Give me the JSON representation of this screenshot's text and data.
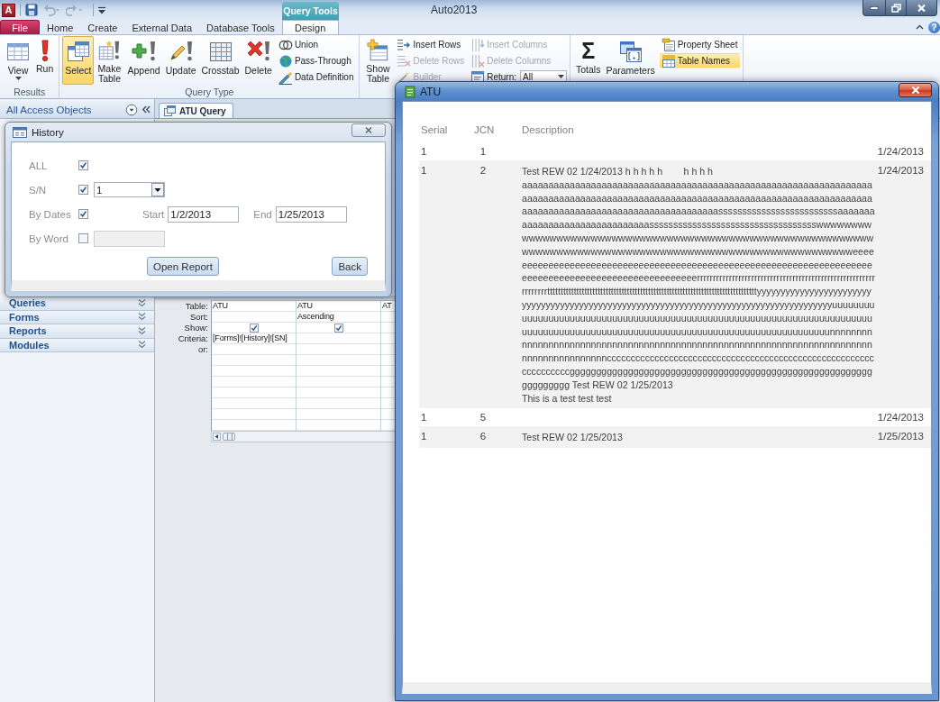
{
  "window": {
    "app_logo": "A",
    "title": "Auto2013",
    "contextual_group": "Query Tools",
    "help_symbol": "?"
  },
  "quick_access": [
    {
      "disabled": false
    },
    {
      "disabled": true
    },
    {
      "disabled": true
    }
  ],
  "ribbon": {
    "tabs": [
      {
        "label": "File",
        "kind": "backstage",
        "selected": false
      },
      {
        "label": "Home",
        "kind": "standard",
        "selected": false
      },
      {
        "label": "Create",
        "kind": "standard",
        "selected": false
      },
      {
        "label": "External Data",
        "kind": "standard",
        "selected": false
      },
      {
        "label": "Database Tools",
        "kind": "standard",
        "selected": false
      },
      {
        "label": "Design",
        "kind": "contextual",
        "selected": true
      }
    ],
    "groups": [
      {
        "label": "Results",
        "items": [
          {
            "kind": "large",
            "label": "View",
            "dropdown": true,
            "selected": false,
            "disabled": false
          },
          {
            "kind": "large",
            "label": "Run",
            "selected": false,
            "disabled": false
          }
        ]
      },
      {
        "label": "Query Type",
        "items": [
          {
            "kind": "large",
            "label": "Select",
            "selected": true,
            "disabled": false
          },
          {
            "kind": "large",
            "label": "Make Table",
            "selected": false,
            "disabled": false
          },
          {
            "kind": "large",
            "label": "Append",
            "selected": false,
            "disabled": false
          },
          {
            "kind": "large",
            "label": "Update",
            "selected": false,
            "disabled": false
          },
          {
            "kind": "large",
            "label": "Crosstab",
            "selected": false,
            "disabled": false
          },
          {
            "kind": "large",
            "label": "Delete",
            "selected": false,
            "disabled": false
          },
          {
            "kind": "stack",
            "items": [
              {
                "kind": "small",
                "label": "Union",
                "selected": false,
                "disabled": false
              },
              {
                "kind": "small",
                "label": "Pass-Through",
                "selected": false,
                "disabled": false
              },
              {
                "kind": "small",
                "label": "Data Definition",
                "selected": false,
                "disabled": false
              }
            ]
          }
        ]
      },
      {
        "items": [
          {
            "kind": "large",
            "label": "Show Table",
            "selected": false,
            "disabled": false
          },
          {
            "kind": "stack",
            "items": [
              {
                "kind": "small",
                "label": "Insert Rows",
                "selected": false,
                "disabled": false
              },
              {
                "kind": "small",
                "label": "Delete Rows",
                "selected": false,
                "disabled": true
              },
              {
                "kind": "small",
                "label": "Builder",
                "selected": false,
                "disabled": true
              }
            ]
          },
          {
            "kind": "stack",
            "items": [
              {
                "kind": "small",
                "label": "Insert Columns",
                "selected": false,
                "disabled": true
              },
              {
                "kind": "small",
                "label": "Delete Columns",
                "selected": false,
                "disabled": true
              },
              {
                "kind": "combo",
                "label": "Return:",
                "value": "All",
                "disabled": false
              }
            ]
          }
        ]
      },
      {
        "items": [
          {
            "kind": "large",
            "label": "Totals",
            "symbol": "Σ",
            "selected": false,
            "disabled": false
          },
          {
            "kind": "large",
            "label": "Parameters",
            "selected": false,
            "disabled": false
          },
          {
            "kind": "stack",
            "items": [
              {
                "kind": "small",
                "label": "Property Sheet",
                "selected": false,
                "disabled": false
              },
              {
                "kind": "small",
                "label": "Table Names",
                "selected": true,
                "disabled": false
              }
            ]
          }
        ]
      }
    ]
  },
  "nav_pane": {
    "title": "All Access Objects",
    "groups": [
      {
        "label": "Queries",
        "expanded": false
      },
      {
        "label": "Forms",
        "expanded": false
      },
      {
        "label": "Reports",
        "expanded": false
      },
      {
        "label": "Modules",
        "expanded": false
      }
    ]
  },
  "document_tabs": [
    {
      "label": "ATU Query",
      "selected": true
    }
  ],
  "query_grid": {
    "row_labels": [
      "Table:",
      "Sort:",
      "Show:",
      "Criteria:",
      "or:"
    ],
    "columns": [
      {
        "table": "ATU",
        "show": true,
        "criteria": "[Forms]![History]![SN]"
      },
      {
        "table": "ATU",
        "sort": "Ascending",
        "show": true
      },
      {
        "table": "AT"
      }
    ]
  },
  "history_dialog": {
    "title": "History",
    "rows": [
      {
        "kind": "check",
        "label": "ALL",
        "checked": true
      },
      {
        "kind": "combo",
        "label": "S/N",
        "checked": true,
        "value": "1"
      },
      {
        "kind": "date_range",
        "label": "By Dates",
        "checked": true,
        "start_label": "Start",
        "start": "1/2/2013",
        "end_label": "End",
        "end": "1/25/2013"
      },
      {
        "kind": "text",
        "label": "By Word",
        "checked": false,
        "disabled": true
      }
    ],
    "buttons": [
      "Open Report",
      "Back"
    ]
  },
  "report_window": {
    "title": "ATU",
    "columns": [
      "Serial",
      "JCN",
      "Description"
    ],
    "rows": [
      {
        "serial": "1",
        "jcn": "1",
        "date": "1/24/2013"
      },
      {
        "serial": "1",
        "jcn": "2",
        "description": "Test REW 02 1/24/2013 h h h h h        h h h h aaaaaaaaaaaaaaaaaaaaaaaaaaaaaaaaaaaaaaaaaaaaaaaaaaaaaaaaaaaaaaaaaaaaaaaaaaaaaaaaaaaaaaaaaaaaaaaaaaaaaaaaaaaaaaaaaaaaaaaaaaaaaaaaaaaaaaaaaaaaaaaaaaaaaaaaaaaaaaaaaaaaaaaaasssssssssssssssssssssssssaaaaaaaaaaaaaaaaaaaaaaaaaaaaaaassssssssssssssssssssssssssssssssssswwwwwwwwwwwwwwwwwwwwwwwwwwwwwwwwwwwwwwwwwwwwwwwwwwwwwwwwwwwwwwwwwwwwwwwwwwwwwwwwwwwwwwwwwwwwwwwwwwwwwwwwwwweeeeeeeeeeeeeeeeeeeeeeeeeeeeeeeeeeeeeeeeeeeeeeeeeeeeeeeeeeeeeeeeeeeeeeeeeeeeeeeeeeeeeeeeeeeeeeeeeeeeeeerrrrrrrrrrrrrrrrrrrrrrrrrrrrrrrrrrrrrrrrrrrrrrrrrrrrrrrrrrrrrrrrtttttttttttttttttttttttttttttttttttttttttttttttttttttttttttttttttttttttttttttttyyyyyyyyyyyyyyyyyyyyyyyyyyyyyyyyyyyyyyyyyyyyyyyyyyyyyyyyyyyyyyyyyyyyyyyyyyyyyyyyyyyyyyyyyuuuuuuuuuuuuuuuuuuuuuuuuuuuuuuuuuuuuuuuuuuuuuuuuuuuuuuuuuuuuuuuuuuuuuuuuuuuuuuuuuuuuuuuuuuuuuuuuuuuuuuuuuuuuuuuuuuuuuuuuuuuuuuuuuuuunnnnnnnnnnnnnnnnnnnnnnnnnnnnnnnnnnnnnnnnnnnnnnnnnnnnnnnnnnnnnnnnnnnnnnnnnnnnnnnnnnnnnnnnnnccccccccccccccccccccccccccccccccccccccccccccccccccccccccccccccccccgggggggggggggggggggggggggggggggggggggggggggggggggggggggggggggggggg Test REW 02 1/25/2013\nThis is a test test test",
        "date": "1/24/2013"
      },
      {
        "serial": "1",
        "jcn": "5",
        "date": "1/24/2013"
      },
      {
        "serial": "1",
        "jcn": "6",
        "description": "Test REW 02 1/25/2013",
        "date": "1/25/2013"
      }
    ]
  }
}
